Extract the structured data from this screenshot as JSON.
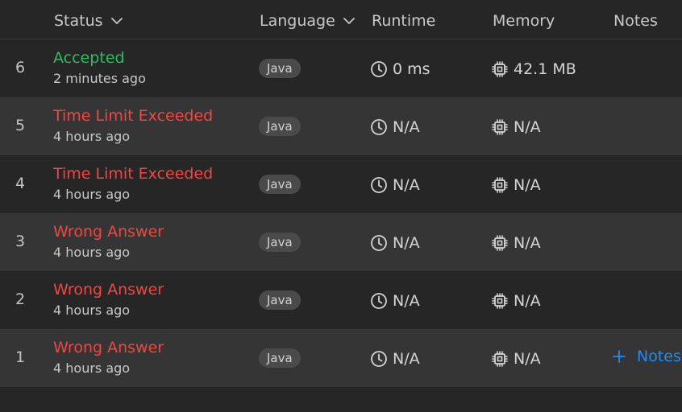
{
  "header": {
    "status": "Status",
    "language": "Language",
    "runtime": "Runtime",
    "memory": "Memory",
    "notes": "Notes"
  },
  "rows": [
    {
      "num": "6",
      "status": "Accepted",
      "status_kind": "accepted",
      "time": "2 minutes ago",
      "language": "Java",
      "runtime": "0 ms",
      "memory": "42.1 MB",
      "notes": ""
    },
    {
      "num": "5",
      "status": "Time Limit Exceeded",
      "status_kind": "error",
      "time": "4 hours ago",
      "language": "Java",
      "runtime": "N/A",
      "memory": "N/A",
      "notes": ""
    },
    {
      "num": "4",
      "status": "Time Limit Exceeded",
      "status_kind": "error",
      "time": "4 hours ago",
      "language": "Java",
      "runtime": "N/A",
      "memory": "N/A",
      "notes": ""
    },
    {
      "num": "3",
      "status": "Wrong Answer",
      "status_kind": "error",
      "time": "4 hours ago",
      "language": "Java",
      "runtime": "N/A",
      "memory": "N/A",
      "notes": ""
    },
    {
      "num": "2",
      "status": "Wrong Answer",
      "status_kind": "error",
      "time": "4 hours ago",
      "language": "Java",
      "runtime": "N/A",
      "memory": "N/A",
      "notes": ""
    },
    {
      "num": "1",
      "status": "Wrong Answer",
      "status_kind": "error",
      "time": "4 hours ago",
      "language": "Java",
      "runtime": "N/A",
      "memory": "N/A",
      "notes": "Notes"
    }
  ],
  "icons": {
    "sort": "chevron-down-icon",
    "runtime": "clock-icon",
    "memory": "chip-icon",
    "add_note": "plus-icon"
  },
  "colors": {
    "accepted": "#2cbb5d",
    "error": "#ef4743",
    "link": "#1d8cf8",
    "background": "#262626",
    "row_alt": "#353535"
  }
}
